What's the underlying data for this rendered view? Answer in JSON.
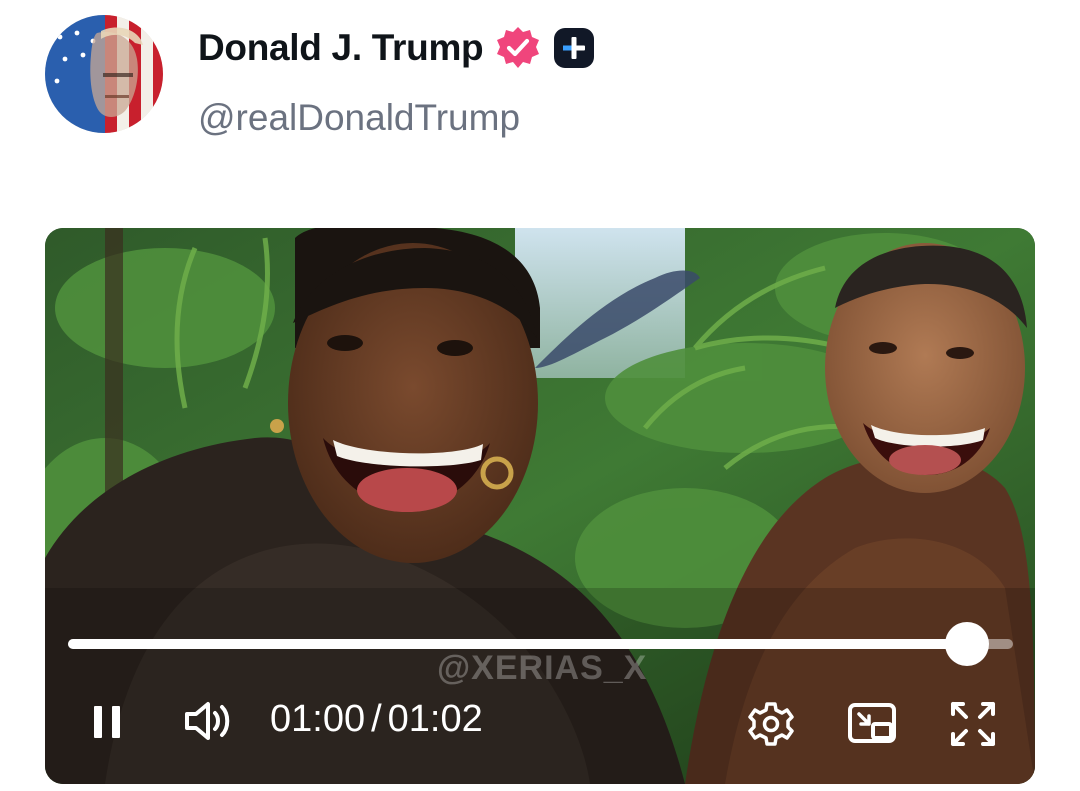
{
  "post": {
    "author": {
      "display_name": "Donald J. Trump",
      "handle": "@realDonaldTrump",
      "badges": [
        "verified-badge-icon",
        "plus-badge-icon"
      ]
    }
  },
  "video": {
    "watermark": "@XERIAS_X",
    "current_time": "01:00",
    "separator": "/",
    "duration": "01:02",
    "progress": 0.951,
    "state": "playing",
    "controls": {
      "play_pause_icon": "pause-icon",
      "volume_icon": "volume-icon",
      "settings_icon": "gear-icon",
      "pip_icon": "picture-in-picture-icon",
      "fullscreen_icon": "fullscreen-icon"
    }
  },
  "colors": {
    "verified_badge": "#f0457c",
    "name_text": "#0f1419",
    "handle_text": "#6b7280",
    "progress_fill": "#ffffff"
  }
}
